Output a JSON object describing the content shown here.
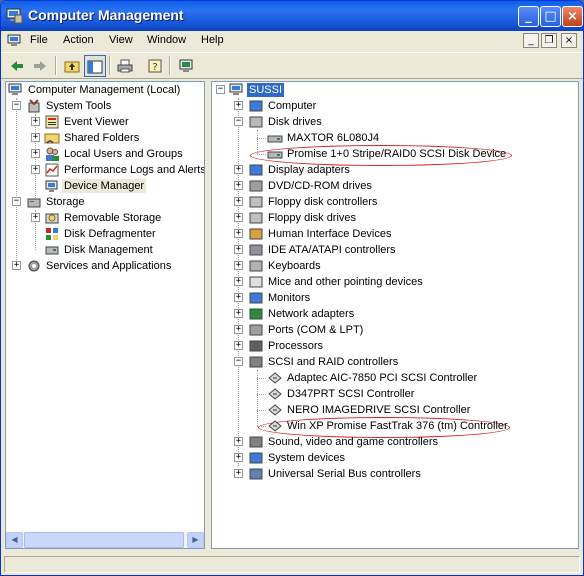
{
  "window": {
    "title": "Computer Management"
  },
  "titlebar_buttons": {
    "minimize": "_",
    "maximize": "□",
    "close": "×"
  },
  "menu": {
    "items": [
      "File",
      "Action",
      "View",
      "Window",
      "Help"
    ]
  },
  "mdi_buttons": {
    "minimize": "_",
    "restore": "❐",
    "close": "×"
  },
  "toolbar": {
    "buttons": [
      "back",
      "forward",
      "up-folder",
      "show-hide-tree",
      "print",
      "help",
      "properties"
    ]
  },
  "left_tree": {
    "root": "Computer Management (Local)",
    "system_tools": "System Tools",
    "system_tools_children": [
      "Event Viewer",
      "Shared Folders",
      "Local Users and Groups",
      "Performance Logs and Alerts",
      "Device Manager"
    ],
    "storage": "Storage",
    "storage_children": [
      "Removable Storage",
      "Disk Defragmenter",
      "Disk Management"
    ],
    "services": "Services and Applications"
  },
  "right_tree": {
    "root": "SUSSI",
    "categories": [
      "Computer",
      "Disk drives",
      "Display adapters",
      "DVD/CD-ROM drives",
      "Floppy disk controllers",
      "Floppy disk drives",
      "Human Interface Devices",
      "IDE ATA/ATAPI controllers",
      "Keyboards",
      "Mice and other pointing devices",
      "Monitors",
      "Network adapters",
      "Ports (COM & LPT)",
      "Processors",
      "SCSI and RAID controllers",
      "Sound, video and game controllers",
      "System devices",
      "Universal Serial Bus controllers"
    ],
    "disk_drives": [
      "MAXTOR 6L080J4",
      "Promise 1+0 Stripe/RAID0 SCSI Disk Device"
    ],
    "scsi_controllers": [
      "Adaptec AIC-7850 PCI SCSI Controller",
      "D347PRT SCSI Controller",
      "NERO IMAGEDRIVE SCSI Controller",
      "Win XP Promise FastTrak 376 (tm) Controller"
    ]
  },
  "colors": {
    "selection": "#316ac5",
    "annotation": "#d42020",
    "titlebar": "#0a5fe8"
  }
}
